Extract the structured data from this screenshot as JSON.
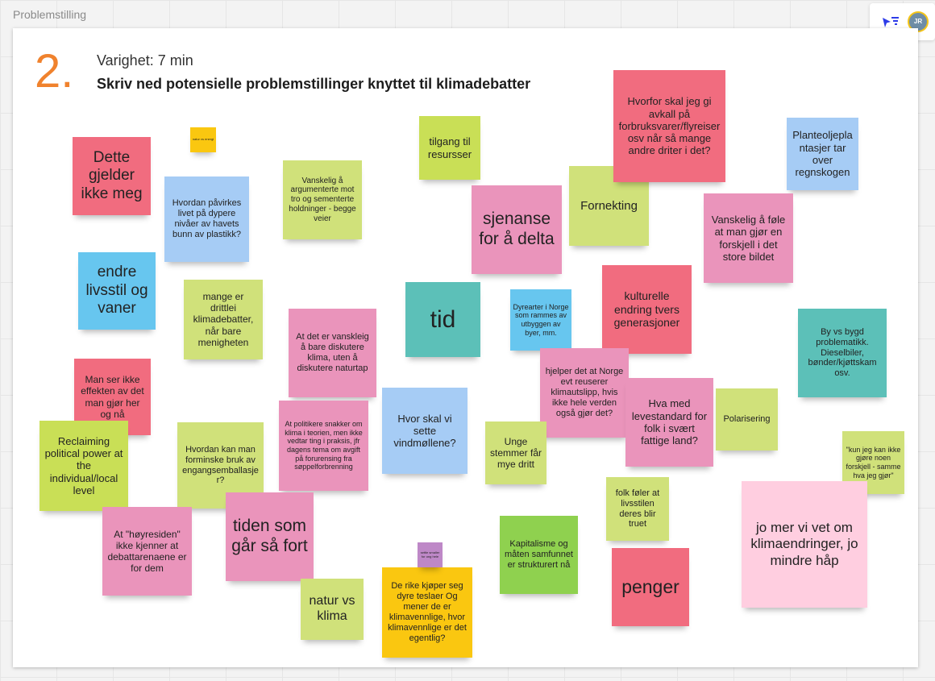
{
  "board": {
    "title": "Problemstilling"
  },
  "toolbar": {
    "avatar_initials": "JR"
  },
  "header": {
    "step": "2.",
    "duration": "Varighet: 7 min",
    "heading": "Skriv ned potensielle problemstillinger knyttet til klimadebatter"
  },
  "colors": {
    "red": "#f16c7f",
    "pink": "#ea94bb",
    "green": "#d0e17a",
    "blue": "#a6ccf5",
    "cyan": "#67c6ef",
    "teal": "#5cc0b8",
    "lime": "#c9df56",
    "yellow": "#fac710",
    "violet": "#be88c7",
    "lightpink": "#ffcee0",
    "darkgreen": "#8fd14f",
    "orange": "#f0822d"
  },
  "notes": [
    {
      "id": "dette-gjelder-ikke-meg",
      "text": "Dette gjelder ikke meg"
    },
    {
      "id": "hvordan-pavirkes-livet",
      "text": "Hvordan påvirkes livet på dypere nivåer av havets bunn av plastikk?"
    },
    {
      "id": "endre-livsstil",
      "text": "endre livsstil og vaner"
    },
    {
      "id": "mange-er-drittlei",
      "text": "mange er drittlei klimadebatter, når bare menigheten"
    },
    {
      "id": "vanskelig-argumentere",
      "text": "Vanskelig å argumenterte mot tro og sementerte holdninger - begge veier"
    },
    {
      "id": "tilgang-til-resursser",
      "text": "tilgang til resursser"
    },
    {
      "id": "sjenanse-for-a-delta",
      "text": "sjenanse for å delta"
    },
    {
      "id": "fornekting",
      "text": "Fornekting"
    },
    {
      "id": "hvorfor-avkall",
      "text": "Hvorfor skal jeg gi avkall på forbruksvarer/flyreiser osv når så mange andre driter i det?"
    },
    {
      "id": "planteoljeplantasjer",
      "text": "Planteoljeplantasjer tar over regnskogen"
    },
    {
      "id": "vanskelig-fole",
      "text": "Vanskelig å føle at man gjør en forskjell i det store bildet"
    },
    {
      "id": "tid",
      "text": "tid"
    },
    {
      "id": "dyrearter",
      "text": "Dyrearter i Norge som rammes av utbyggen av byer, mm."
    },
    {
      "id": "kulturelle-endring",
      "text": "kulturelle endring tvers generasjoner"
    },
    {
      "id": "by-vs-bygd",
      "text": "By vs bygd problematikk. Dieselbiler, bønder/kjøttskam osv."
    },
    {
      "id": "man-ser-ikke-effekten",
      "text": "Man ser ikke effekten av det man gjør her og nå"
    },
    {
      "id": "at-det-er-vanskleig",
      "text": "At det er vanskleig å bare diskutere klima, uten å diskutere naturtap"
    },
    {
      "id": "at-politikere",
      "text": "At politikere snakker om klima i teorien, men ikke vedtar ting i praksis, jfr dagens tema om avgift på forurensing fra søppelforbrenning"
    },
    {
      "id": "hvor-skal-vindmollene",
      "text": "Hvor skal vi sette vindmøllene?"
    },
    {
      "id": "hjelper-det-norge",
      "text": "hjelper det at Norge evt reuserer klimautslipp, hvis ikke hele verden også gjør det?"
    },
    {
      "id": "hva-med-levestandard",
      "text": "Hva med levestandard for folk i svært fattige land?"
    },
    {
      "id": "polarisering",
      "text": "Polarisering"
    },
    {
      "id": "reclaiming-political-power",
      "text": "Reclaiming political power at the individual/local level"
    },
    {
      "id": "hvordan-forminske-bruk",
      "text": "Hvordan kan man forminske bruk av engangsemballasjer?"
    },
    {
      "id": "unge-stemmer",
      "text": "Unge stemmer får mye dritt"
    },
    {
      "id": "kun-jeg-kan-ikke",
      "text": "\"kun jeg kan ikke gjøre noen forskjell - samme hva jeg gjør\""
    },
    {
      "id": "tiden-som-gar",
      "text": "tiden som går så fort"
    },
    {
      "id": "hoyresiden",
      "text": "At \"høyresiden\" ikke kjenner at debattarenaene er for dem"
    },
    {
      "id": "folk-foler",
      "text": "folk føler at livsstilen deres blir truet"
    },
    {
      "id": "kapitalisme",
      "text": "Kapitalisme og måten samfunnet er strukturert nå"
    },
    {
      "id": "jo-mer-vi-vet",
      "text": "jo mer vi vet om klimaendringer, jo mindre håp"
    },
    {
      "id": "natur-vs-klima",
      "text": "natur vs klima"
    },
    {
      "id": "de-rike",
      "text": "De rike kjøper seg dyre teslaer Og mener de er klimavennlige, hvor klimavennlige er det egentlig?"
    },
    {
      "id": "penger",
      "text": "penger"
    },
    {
      "id": "small-yellow",
      "text": "natur vs energi"
    },
    {
      "id": "small-violet",
      "text": "settle smaller for ong hele"
    }
  ]
}
